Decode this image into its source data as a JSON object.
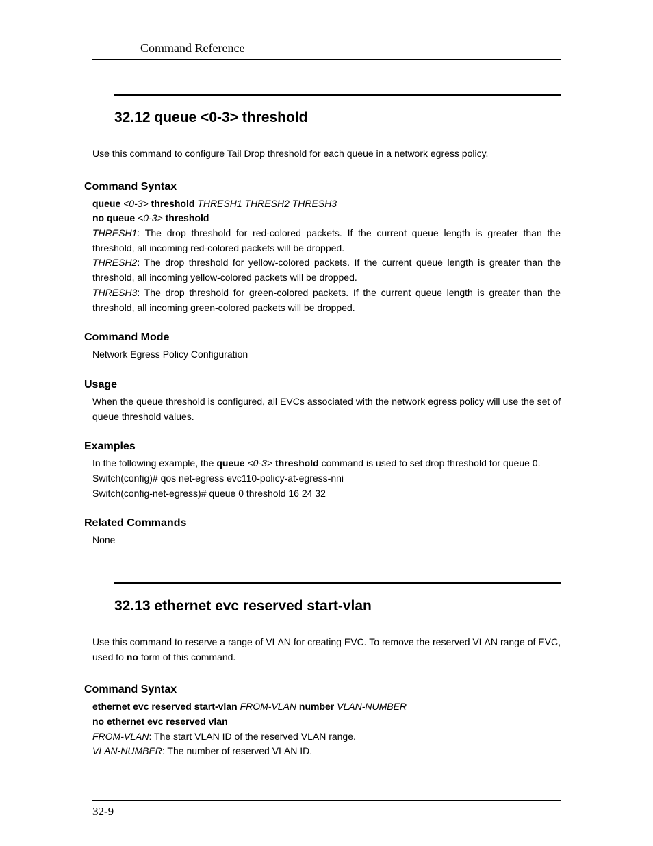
{
  "header": {
    "running_title": "Command Reference"
  },
  "s1": {
    "title": "32.12   queue <0-3> threshold",
    "intro": "Use this command to configure Tail Drop threshold for each queue in a network egress policy.",
    "syntax": {
      "heading": "Command Syntax",
      "line1_bold1": "queue ",
      "line1_it1": "<0-3> ",
      "line1_bold2": "threshold ",
      "line1_it2": "THRESH1 THRESH2 THRESH3",
      "line2_bold1": "no queue ",
      "line2_it1": "<0-3> ",
      "line2_bold2": "threshold",
      "t1_head": "THRESH1",
      "t1_body": ": The drop threshold for red-colored packets. If the current queue length is greater than the threshold, all incoming red-colored packets will be dropped.",
      "t2_head": "THRESH2",
      "t2_body": ": The drop threshold for yellow-colored packets. If the current queue length is greater than the threshold, all incoming yellow-colored packets will be dropped.",
      "t3_head": "THRESH3",
      "t3_body": ": The drop threshold for green-colored packets. If the current queue length is greater than the threshold, all incoming green-colored packets will be dropped."
    },
    "mode": {
      "heading": "Command Mode",
      "body": "Network Egress Policy Configuration"
    },
    "usage": {
      "heading": "Usage",
      "body": "When the queue threshold is configured, all EVCs associated with the network egress policy will use the set of queue threshold values."
    },
    "examples": {
      "heading": "Examples",
      "pre": "In the following example, the ",
      "b1": "queue ",
      "i1": "<0-3> ",
      "b2": "threshold ",
      "post": "command is used to set drop threshold for queue 0.",
      "cli1": "Switch(config)# qos net-egress evc110-policy-at-egress-nni",
      "cli2": "Switch(config-net-egress)# queue 0 threshold 16 24 32"
    },
    "related": {
      "heading": "Related Commands",
      "body": "None"
    }
  },
  "s2": {
    "title": "32.13   ethernet evc reserved start-vlan",
    "intro_pre": "Use this command to reserve a range of VLAN for creating EVC. To remove the reserved VLAN range of EVC, used to ",
    "intro_bold": "no",
    "intro_post": " form of this command.",
    "syntax": {
      "heading": "Command Syntax",
      "l1_b1": "ethernet evc reserved start-vlan ",
      "l1_i1": "FROM-VLAN ",
      "l1_b2": "number ",
      "l1_i2": "VLAN-NUMBER",
      "l2": "no ethernet evc reserved vlan",
      "p1_head": "FROM-VLAN",
      "p1_body": ": The start VLAN ID of the reserved VLAN range.",
      "p2_head": "VLAN-NUMBER",
      "p2_body": ": The number of reserved VLAN ID."
    }
  },
  "footer": {
    "page_num": "32-9"
  }
}
